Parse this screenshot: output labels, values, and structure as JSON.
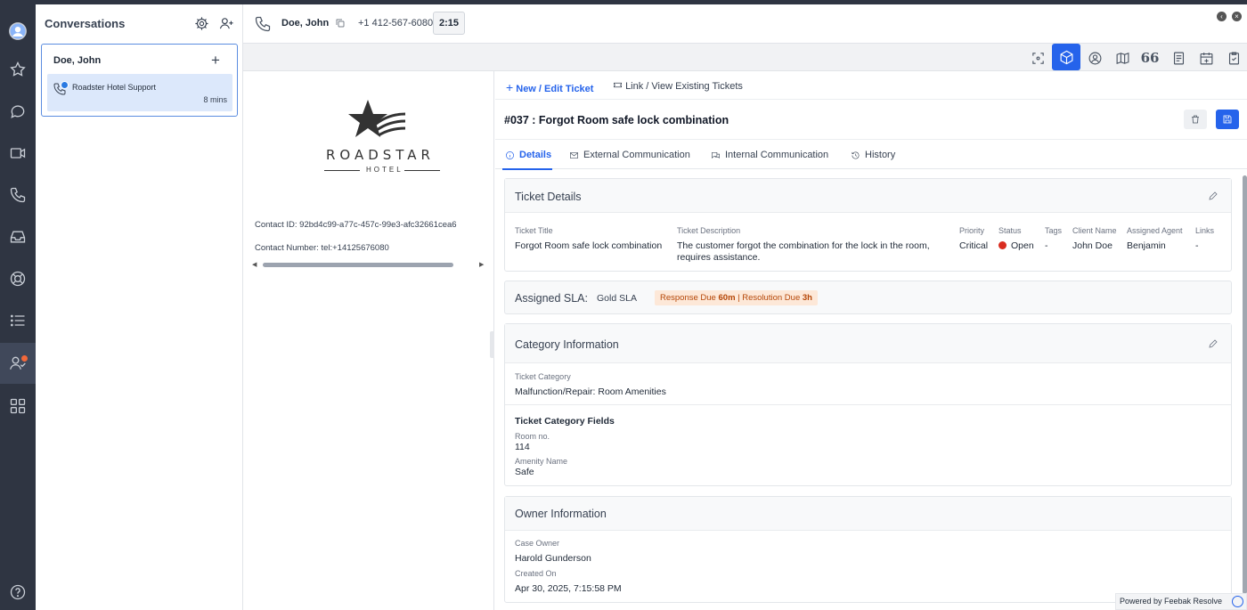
{
  "conversations": {
    "title": "Conversations",
    "contact_name": "Doe, John",
    "item": {
      "label": "Roadster Hotel Support",
      "time": "8 mins"
    }
  },
  "call": {
    "name": "Doe, John",
    "number": "+1 412-567-6080",
    "timer": "2:15"
  },
  "contact": {
    "brand": "ROADSTAR",
    "brand_sub": "HOTEL",
    "id_line": "Contact ID: 92bd4c99-a77c-457c-99e3-afc32661cea6",
    "number_line": "Contact Number: tel:+14125676080"
  },
  "ticket": {
    "new_edit_label": "New / Edit Ticket",
    "link_view_label": "Link / View Existing Tickets",
    "title": "#037 : Forgot Room safe lock combination",
    "tabs": {
      "details": "Details",
      "external": "External Communication",
      "internal": "Internal Communication",
      "history": "History"
    },
    "details_card": {
      "title": "Ticket Details",
      "labels": {
        "title": "Ticket Title",
        "description": "Ticket Description",
        "priority": "Priority",
        "status": "Status",
        "tags": "Tags",
        "client": "Client Name",
        "agent": "Assigned Agent",
        "links": "Links"
      },
      "values": {
        "title": "Forgot Room safe lock combination",
        "description": "The customer forgot the combination for the lock in the room, requires assistance.",
        "priority": "Critical",
        "status": "Open",
        "tags": "-",
        "client": "John Doe",
        "agent": "Benjamin",
        "links": "-"
      },
      "status_color": "#d92d20"
    },
    "sla": {
      "title": "Assigned SLA:",
      "tier": "Gold SLA",
      "response_label": "Response Due",
      "response_value": "60m",
      "separator": "|",
      "resolution_label": "Resolution Due",
      "resolution_value": "3h"
    },
    "category_card": {
      "title": "Category Information",
      "category_label": "Ticket Category",
      "category_value": "Malfunction/Repair: Room Amenities",
      "fields_title": "Ticket Category Fields",
      "room_label": "Room no.",
      "room_value": "114",
      "amenity_label": "Amenity Name",
      "amenity_value": "Safe"
    },
    "owner_card": {
      "title": "Owner Information",
      "owner_label": "Case Owner",
      "owner_value": "Harold Gunderson",
      "created_label": "Created On",
      "created_value": "Apr 30, 2025, 7:15:58 PM"
    }
  },
  "footer": {
    "text": "Powered by Feebak Resolve"
  },
  "colors": {
    "accent": "#2563eb",
    "rail": "#2f3542"
  }
}
